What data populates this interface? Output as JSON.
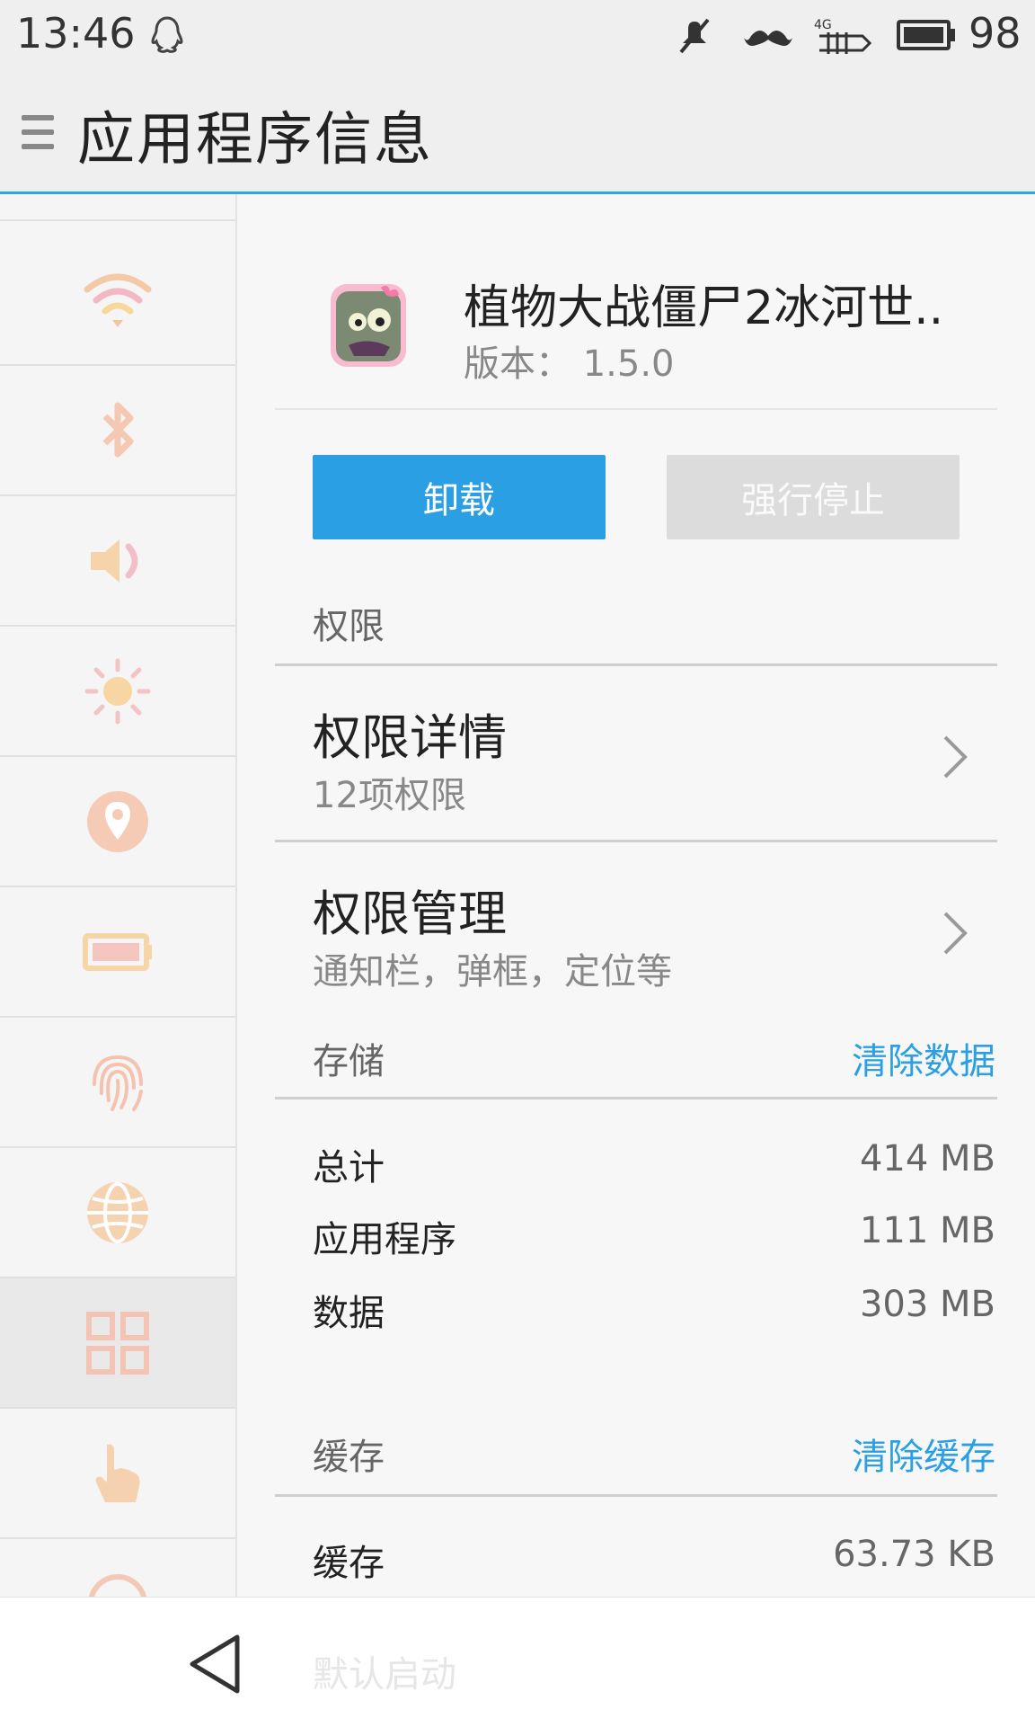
{
  "status_bar": {
    "time": "13:46",
    "battery_level": "98",
    "icons": [
      "qq-icon",
      "mute-icon",
      "mustache-icon",
      "4g-signal-icon",
      "battery-icon"
    ]
  },
  "app_bar": {
    "title": "应用程序信息"
  },
  "sidebar": {
    "items": [
      {
        "icon": "wifi-icon"
      },
      {
        "icon": "bluetooth-icon"
      },
      {
        "icon": "speaker-icon"
      },
      {
        "icon": "brightness-icon"
      },
      {
        "icon": "location-icon"
      },
      {
        "icon": "battery-icon"
      },
      {
        "icon": "fingerprint-icon"
      },
      {
        "icon": "globe-icon"
      },
      {
        "icon": "apps-grid-icon",
        "active": true
      },
      {
        "icon": "hand-gesture-icon"
      },
      {
        "icon": "info-icon"
      }
    ]
  },
  "app": {
    "name": "植物大战僵尸2冰河世..",
    "version": "版本： 1.5.0"
  },
  "buttons": {
    "uninstall": "卸载",
    "force_stop": "强行停止"
  },
  "permissions": {
    "section_label": "权限",
    "details_title": "权限详情",
    "details_sub": "12项权限",
    "manage_title": "权限管理",
    "manage_sub": "通知栏，弹框，定位等"
  },
  "storage": {
    "section_label": "存储",
    "clear_data": "清除数据",
    "rows": [
      {
        "label": "总计",
        "value": "414 MB"
      },
      {
        "label": "应用程序",
        "value": "111 MB"
      },
      {
        "label": "数据",
        "value": "303 MB"
      }
    ]
  },
  "cache": {
    "section_label": "缓存",
    "clear_cache": "清除缓存",
    "row_label": "缓存",
    "row_value": "63.73 KB"
  },
  "footer_ghost": "默认启动",
  "colors": {
    "accent": "#2b9fe3",
    "appbar_underline": "#2aa6e2",
    "disabled_button": "#dcdcdc"
  }
}
